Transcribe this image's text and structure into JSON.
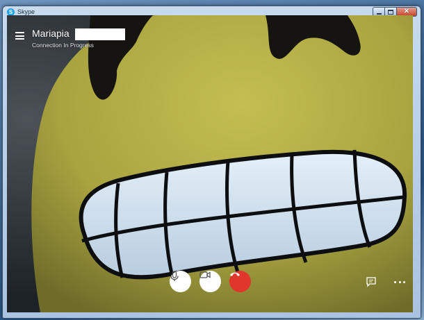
{
  "window": {
    "title": "Skype",
    "app_icon_letter": "S"
  },
  "call": {
    "contact_name": "Mariapia",
    "status": "Connection In Progress"
  },
  "controls": {
    "mic_icon": "microphone-icon",
    "video_icon": "video-camera-icon",
    "end_icon": "hang-up-icon",
    "chat_icon": "chat-icon",
    "more_icon": "more-options-icon"
  },
  "colors": {
    "end_call": "#e0362b",
    "control_bg": "#ffffff",
    "face_yellow": "#b9b349",
    "teeth": "#d6e6f2",
    "outline": "#0d0e10"
  }
}
